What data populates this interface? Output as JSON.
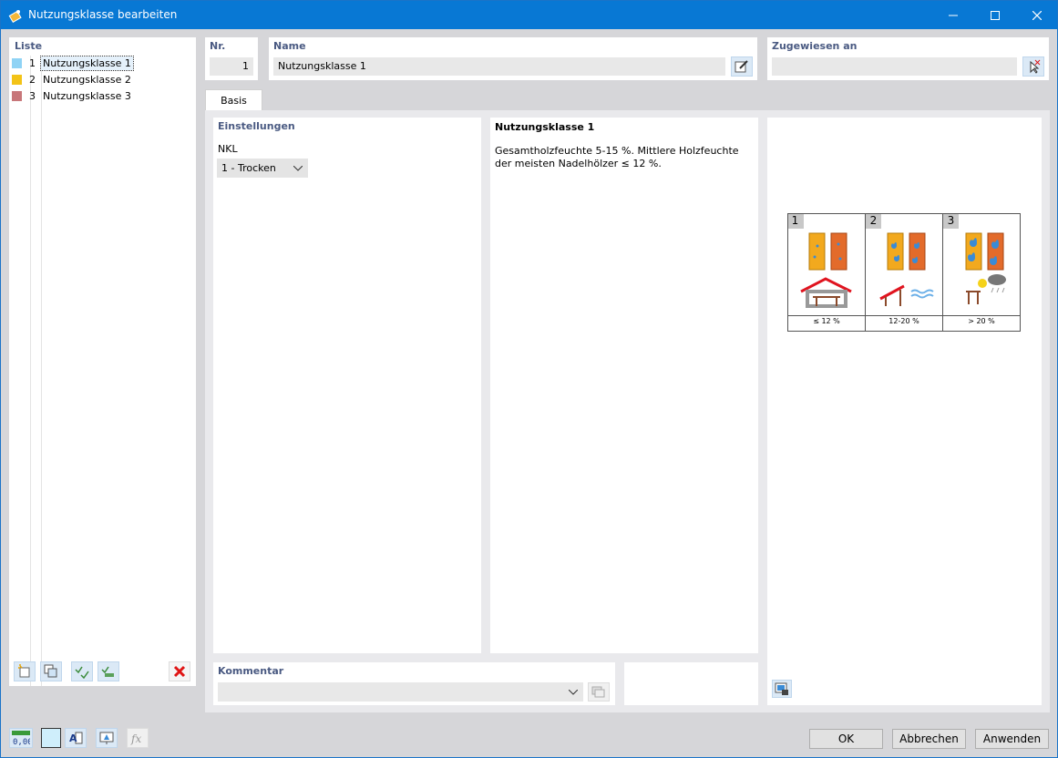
{
  "window": {
    "title": "Nutzungsklasse bearbeiten"
  },
  "list": {
    "label": "Liste",
    "items": [
      {
        "num": "1",
        "name": "Nutzungsklasse 1",
        "color": "#8fd3f5"
      },
      {
        "num": "2",
        "name": "Nutzungsklasse 2",
        "color": "#f3c317"
      },
      {
        "num": "3",
        "name": "Nutzungsklasse 3",
        "color": "#c8777a"
      }
    ]
  },
  "header": {
    "nr_label": "Nr.",
    "nr_value": "1",
    "name_label": "Name",
    "name_value": "Nutzungsklasse 1",
    "assigned_label": "Zugewiesen an",
    "assigned_value": ""
  },
  "tabs": [
    {
      "label": "Basis"
    }
  ],
  "settings": {
    "label": "Einstellungen",
    "nkl_label": "NKL",
    "nkl_value": "1 - Trocken"
  },
  "info": {
    "title": "Nutzungsklasse 1",
    "text": "Gesamtholzfeuchte 5-15 %. Mittlere Holzfeuchte der meisten Nadelhölzer ≤ 12 %."
  },
  "diagram": {
    "classes": [
      {
        "num": "1",
        "label": "≤ 12 %"
      },
      {
        "num": "2",
        "label": "12-20 %"
      },
      {
        "num": "3",
        "label": "> 20 %"
      }
    ]
  },
  "comment": {
    "label": "Kommentar",
    "value": ""
  },
  "buttons": {
    "ok": "OK",
    "cancel": "Abbrechen",
    "apply": "Anwenden"
  },
  "colors": {
    "titlebar": "#0878d4",
    "wood": "#f2a91e",
    "brick": "#e36b2b",
    "drop": "#3a8bd6",
    "roof": "#e0141f"
  }
}
